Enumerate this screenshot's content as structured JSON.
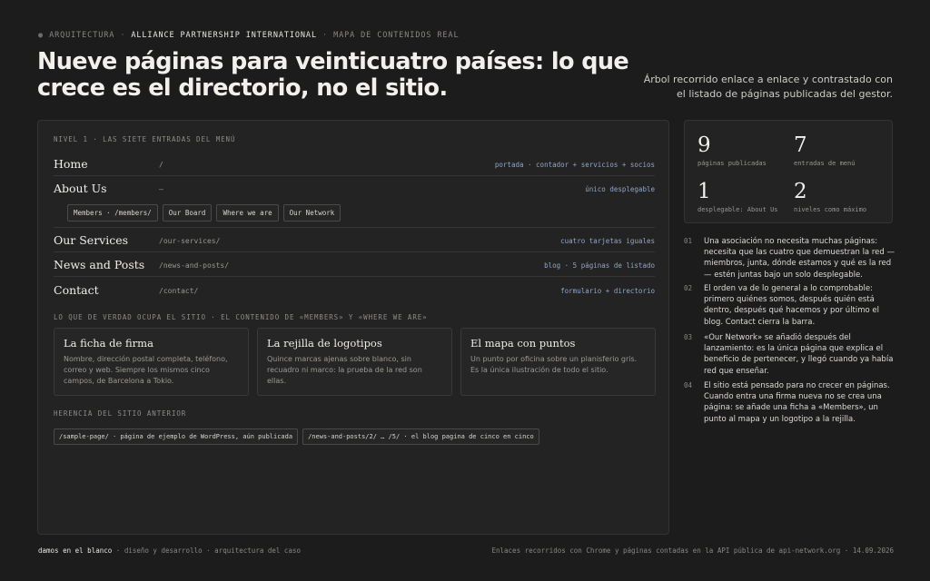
{
  "header": {
    "eyebrow_bullet": "●",
    "eyebrow_1": "ARQUITECTURA",
    "eyebrow_sep": "·",
    "eyebrow_2": "ALLIANCE PARTNERSHIP INTERNATIONAL",
    "eyebrow_3": "MAPA DE CONTENIDOS REAL",
    "headline_line1": "Nueve páginas para veinticuatro países: lo que",
    "headline_line2": "crece es el directorio, no el sitio.",
    "lede_line1": "Árbol recorrido enlace a enlace y contrastado con",
    "lede_line2": "el listado de páginas publicadas del gestor."
  },
  "menu": {
    "section_label": "NIVEL 1 · LAS SIETE ENTRADAS DEL MENÚ",
    "items": [
      {
        "name": "Home",
        "path": "/",
        "note": "portada · contador + servicios + socios"
      },
      {
        "name": "About Us",
        "path": "—",
        "note": "único desplegable"
      },
      {
        "name": "Our Services",
        "path": "/our-services/",
        "note": "cuatro tarjetas iguales"
      },
      {
        "name": "News and Posts",
        "path": "/news-and-posts/",
        "note": "blog · 5 páginas de listado"
      },
      {
        "name": "Contact",
        "path": "/contact/",
        "note": "formulario + directorio"
      }
    ],
    "submenu": [
      "Members · /members/",
      "Our Board",
      "Where we are",
      "Our Network"
    ]
  },
  "content": {
    "section_label": "LO QUE DE VERDAD OCUPA EL SITIO · EL CONTENIDO DE «MEMBERS» Y «WHERE WE ARE»",
    "cards": [
      {
        "title": "La ficha de firma",
        "text": "Nombre, dirección postal completa, teléfono, correo y web. Siempre los mismos cinco campos, de Barcelona a Tokio."
      },
      {
        "title": "La rejilla de logotipos",
        "text": "Quince marcas ajenas sobre blanco, sin recuadro ni marco: la prueba de la red son ellas."
      },
      {
        "title": "El mapa con puntos",
        "text": "Un punto por oficina sobre un planisferio gris. Es la única ilustración de todo el sitio."
      }
    ]
  },
  "legacy": {
    "section_label": "HERENCIA DEL SITIO ANTERIOR",
    "items": [
      "/sample-page/ · página de ejemplo de WordPress, aún publicada",
      "/news-and-posts/2/ … /5/ · el blog pagina de cinco en cinco"
    ]
  },
  "stats": [
    {
      "number": "9",
      "label": "páginas publicadas"
    },
    {
      "number": "7",
      "label": "entradas de menú"
    },
    {
      "number": "1",
      "label": "desplegable: About Us"
    },
    {
      "number": "2",
      "label": "niveles como máximo"
    }
  ],
  "notes": [
    {
      "num": "01",
      "text": "Una asociación no necesita muchas páginas: necesita que las cuatro que demuestran la red — miembros, junta, dónde estamos y qué es la red— estén juntas bajo un solo desplegable."
    },
    {
      "num": "02",
      "text": "El orden va de lo general a lo comprobable: primero quiénes somos, después quién está dentro, después qué hacemos y por último el blog. Contact cierra la barra."
    },
    {
      "num": "03",
      "text": "«Our Network» se añadió después del lanzamiento: es la única página que explica el beneficio de pertenecer, y llegó cuando ya había red que enseñar."
    },
    {
      "num": "04",
      "text": "El sitio está pensado para no crecer en páginas. Cuando entra una firma nueva no se crea una página: se añade una ficha a «Members», un punto al mapa y un logotipo a la rejilla."
    }
  ],
  "footer": {
    "brand": "damos en el blanco",
    "sep": "·",
    "left_2": "diseño y desarrollo",
    "left_3": "arquitectura del caso",
    "right": "Enlaces recorridos con Chrome y páginas contadas en la API pública de api-network.org · 14.09.2026"
  }
}
